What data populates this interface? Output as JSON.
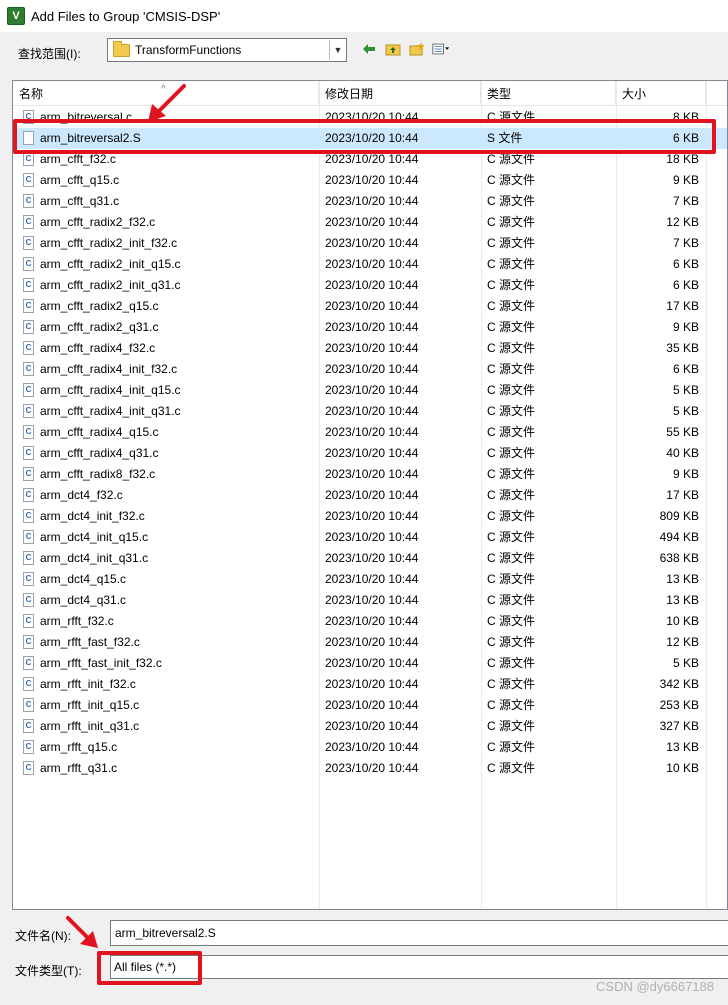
{
  "window": {
    "title": "Add Files to Group 'CMSIS-DSP'",
    "app_icon": "V"
  },
  "look_in": {
    "label": "查找范围(I):",
    "value": "TransformFunctions"
  },
  "toolbar": {
    "back_icon": "back-arrow-icon",
    "up_icon": "up-folder-icon",
    "new_folder_icon": "new-folder-icon",
    "view_icon": "view-menu-icon"
  },
  "columns": {
    "name": "名称",
    "date": "修改日期",
    "type": "类型",
    "size": "大小"
  },
  "files": [
    {
      "name": "arm_bitreversal.c",
      "date": "2023/10/20 10:44",
      "type": "C 源文件",
      "size": "8 KB",
      "icon": "c-source-file-icon"
    },
    {
      "name": "arm_bitreversal2.S",
      "date": "2023/10/20 10:44",
      "type": "S 文件",
      "size": "6 KB",
      "icon": "generic-file-icon",
      "selected": true
    },
    {
      "name": "arm_cfft_f32.c",
      "date": "2023/10/20 10:44",
      "type": "C 源文件",
      "size": "18 KB",
      "icon": "c-source-file-icon"
    },
    {
      "name": "arm_cfft_q15.c",
      "date": "2023/10/20 10:44",
      "type": "C 源文件",
      "size": "9 KB",
      "icon": "c-source-file-icon"
    },
    {
      "name": "arm_cfft_q31.c",
      "date": "2023/10/20 10:44",
      "type": "C 源文件",
      "size": "7 KB",
      "icon": "c-source-file-icon"
    },
    {
      "name": "arm_cfft_radix2_f32.c",
      "date": "2023/10/20 10:44",
      "type": "C 源文件",
      "size": "12 KB",
      "icon": "c-source-file-icon"
    },
    {
      "name": "arm_cfft_radix2_init_f32.c",
      "date": "2023/10/20 10:44",
      "type": "C 源文件",
      "size": "7 KB",
      "icon": "c-source-file-icon"
    },
    {
      "name": "arm_cfft_radix2_init_q15.c",
      "date": "2023/10/20 10:44",
      "type": "C 源文件",
      "size": "6 KB",
      "icon": "c-source-file-icon"
    },
    {
      "name": "arm_cfft_radix2_init_q31.c",
      "date": "2023/10/20 10:44",
      "type": "C 源文件",
      "size": "6 KB",
      "icon": "c-source-file-icon"
    },
    {
      "name": "arm_cfft_radix2_q15.c",
      "date": "2023/10/20 10:44",
      "type": "C 源文件",
      "size": "17 KB",
      "icon": "c-source-file-icon"
    },
    {
      "name": "arm_cfft_radix2_q31.c",
      "date": "2023/10/20 10:44",
      "type": "C 源文件",
      "size": "9 KB",
      "icon": "c-source-file-icon"
    },
    {
      "name": "arm_cfft_radix4_f32.c",
      "date": "2023/10/20 10:44",
      "type": "C 源文件",
      "size": "35 KB",
      "icon": "c-source-file-icon"
    },
    {
      "name": "arm_cfft_radix4_init_f32.c",
      "date": "2023/10/20 10:44",
      "type": "C 源文件",
      "size": "6 KB",
      "icon": "c-source-file-icon"
    },
    {
      "name": "arm_cfft_radix4_init_q15.c",
      "date": "2023/10/20 10:44",
      "type": "C 源文件",
      "size": "5 KB",
      "icon": "c-source-file-icon"
    },
    {
      "name": "arm_cfft_radix4_init_q31.c",
      "date": "2023/10/20 10:44",
      "type": "C 源文件",
      "size": "5 KB",
      "icon": "c-source-file-icon"
    },
    {
      "name": "arm_cfft_radix4_q15.c",
      "date": "2023/10/20 10:44",
      "type": "C 源文件",
      "size": "55 KB",
      "icon": "c-source-file-icon"
    },
    {
      "name": "arm_cfft_radix4_q31.c",
      "date": "2023/10/20 10:44",
      "type": "C 源文件",
      "size": "40 KB",
      "icon": "c-source-file-icon"
    },
    {
      "name": "arm_cfft_radix8_f32.c",
      "date": "2023/10/20 10:44",
      "type": "C 源文件",
      "size": "9 KB",
      "icon": "c-source-file-icon"
    },
    {
      "name": "arm_dct4_f32.c",
      "date": "2023/10/20 10:44",
      "type": "C 源文件",
      "size": "17 KB",
      "icon": "c-source-file-icon"
    },
    {
      "name": "arm_dct4_init_f32.c",
      "date": "2023/10/20 10:44",
      "type": "C 源文件",
      "size": "809 KB",
      "icon": "c-source-file-icon"
    },
    {
      "name": "arm_dct4_init_q15.c",
      "date": "2023/10/20 10:44",
      "type": "C 源文件",
      "size": "494 KB",
      "icon": "c-source-file-icon"
    },
    {
      "name": "arm_dct4_init_q31.c",
      "date": "2023/10/20 10:44",
      "type": "C 源文件",
      "size": "638 KB",
      "icon": "c-source-file-icon"
    },
    {
      "name": "arm_dct4_q15.c",
      "date": "2023/10/20 10:44",
      "type": "C 源文件",
      "size": "13 KB",
      "icon": "c-source-file-icon"
    },
    {
      "name": "arm_dct4_q31.c",
      "date": "2023/10/20 10:44",
      "type": "C 源文件",
      "size": "13 KB",
      "icon": "c-source-file-icon"
    },
    {
      "name": "arm_rfft_f32.c",
      "date": "2023/10/20 10:44",
      "type": "C 源文件",
      "size": "10 KB",
      "icon": "c-source-file-icon"
    },
    {
      "name": "arm_rfft_fast_f32.c",
      "date": "2023/10/20 10:44",
      "type": "C 源文件",
      "size": "12 KB",
      "icon": "c-source-file-icon"
    },
    {
      "name": "arm_rfft_fast_init_f32.c",
      "date": "2023/10/20 10:44",
      "type": "C 源文件",
      "size": "5 KB",
      "icon": "c-source-file-icon"
    },
    {
      "name": "arm_rfft_init_f32.c",
      "date": "2023/10/20 10:44",
      "type": "C 源文件",
      "size": "342 KB",
      "icon": "c-source-file-icon"
    },
    {
      "name": "arm_rfft_init_q15.c",
      "date": "2023/10/20 10:44",
      "type": "C 源文件",
      "size": "253 KB",
      "icon": "c-source-file-icon"
    },
    {
      "name": "arm_rfft_init_q31.c",
      "date": "2023/10/20 10:44",
      "type": "C 源文件",
      "size": "327 KB",
      "icon": "c-source-file-icon"
    },
    {
      "name": "arm_rfft_q15.c",
      "date": "2023/10/20 10:44",
      "type": "C 源文件",
      "size": "13 KB",
      "icon": "c-source-file-icon"
    },
    {
      "name": "arm_rfft_q31.c",
      "date": "2023/10/20 10:44",
      "type": "C 源文件",
      "size": "10 KB",
      "icon": "c-source-file-icon"
    }
  ],
  "file_name": {
    "label": "文件名(N):",
    "value": "arm_bitreversal2.S"
  },
  "file_type": {
    "label": "文件类型(T):",
    "value": "All files (*.*)"
  },
  "watermark": "CSDN @dy6667188",
  "colors": {
    "annotation_red": "#e0141e",
    "selection": "#cce8ff"
  }
}
